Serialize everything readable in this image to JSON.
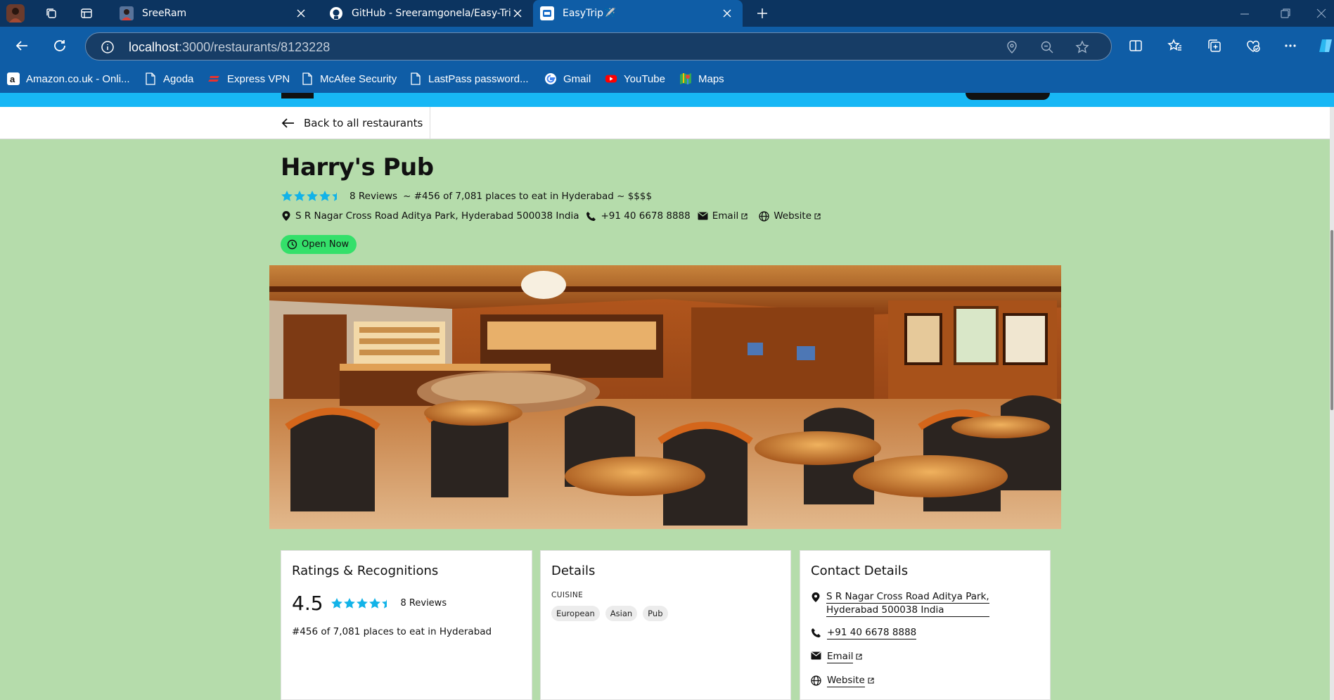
{
  "browser": {
    "tabs": [
      {
        "label": "SreeRam",
        "active": false
      },
      {
        "label": "GitHub - Sreeramgonela/Easy-Trip",
        "active": false
      },
      {
        "label": "EasyTrip✈️",
        "active": true
      }
    ],
    "url_host": "localhost",
    "url_path": ":3000/restaurants/8123228",
    "bookmarks": [
      {
        "label": "Amazon.co.uk - Onli...",
        "icon": "amazon-icon"
      },
      {
        "label": "Agoda",
        "icon": "page-icon"
      },
      {
        "label": "Express VPN",
        "icon": "expressvpn-icon"
      },
      {
        "label": "McAfee Security",
        "icon": "page-icon"
      },
      {
        "label": "LastPass password...",
        "icon": "page-icon"
      },
      {
        "label": "Gmail",
        "icon": "google-icon"
      },
      {
        "label": "YouTube",
        "icon": "youtube-icon"
      },
      {
        "label": "Maps",
        "icon": "maps-icon"
      }
    ]
  },
  "page": {
    "back_label": "Back to all restaurants",
    "restaurant": {
      "name": "Harry's Pub",
      "rating": 4.5,
      "reviews": "8 Reviews",
      "rank_line": "~ #456 of 7,081 places to eat in Hyderabad ~ $$$$",
      "address": "S R Nagar Cross Road Aditya Park, Hyderabad 500038 India",
      "phone": "+91 40 6678 8888",
      "email": "Email",
      "website": "Website",
      "status": "Open Now"
    },
    "cards": {
      "ratings": {
        "title": "Ratings & Recognitions",
        "score": "4.5",
        "reviews": "8 Reviews",
        "rank": "#456 of 7,081 places to eat in Hyderabad"
      },
      "details": {
        "title": "Details",
        "cuisine_heading": "CUISINE",
        "cuisines": [
          "European",
          "Asian",
          "Pub"
        ]
      },
      "contact": {
        "title": "Contact Details",
        "address_line1": "S R Nagar Cross Road Aditya Park,",
        "address_line2": "Hyderabad 500038 India",
        "phone": "+91 40 6678 8888",
        "email": "Email",
        "website": "Website"
      }
    }
  },
  "colors": {
    "page_bg": "#b5dcab",
    "accent_strip": "#17b7f5",
    "star": "#12b3e8",
    "open_badge": "#34e06a",
    "browser_frame": "#0c3460",
    "browser_toolbar": "#0f5da6"
  }
}
